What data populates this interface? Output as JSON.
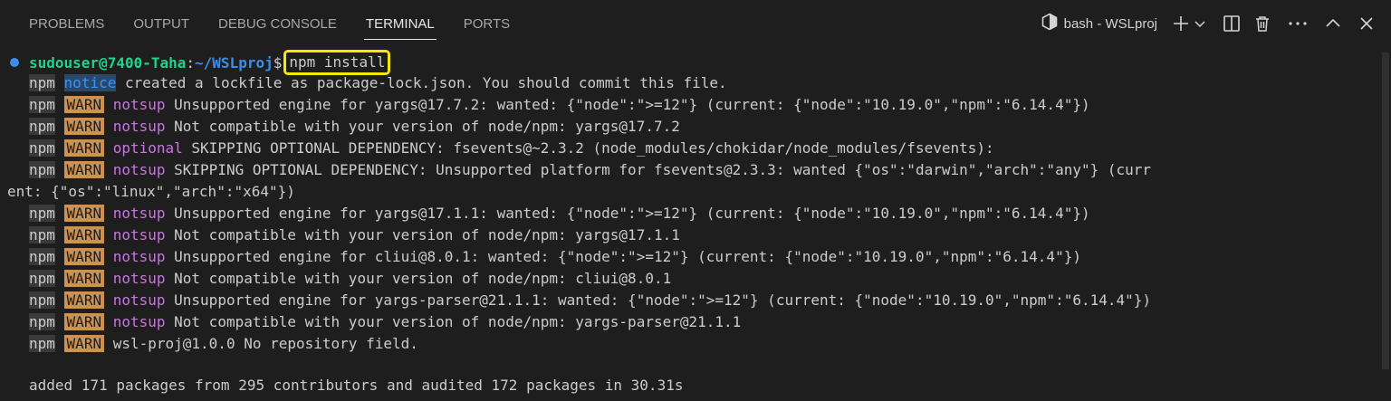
{
  "panel": {
    "tabs": [
      {
        "label": "PROBLEMS"
      },
      {
        "label": "OUTPUT"
      },
      {
        "label": "DEBUG CONSOLE"
      },
      {
        "label": "TERMINAL",
        "active": true
      },
      {
        "label": "PORTS"
      }
    ],
    "terminal_name": "bash - WSLproj",
    "icons": [
      "terminal-shell-icon",
      "plus-icon",
      "chevron-down-icon",
      "split-icon",
      "trash-icon",
      "more-icon",
      "chevron-up-icon",
      "close-icon"
    ]
  },
  "terminal": {
    "prompt": {
      "user": "sudouser@7400-Taha",
      "colon": ":",
      "path": "~/WSLproj",
      "dollar": "$",
      "command": "npm install"
    },
    "npm_label": "npm",
    "warn_label": "WARN",
    "notice_label": "notice",
    "lines": [
      {
        "badge": "notice",
        "tag": "",
        "text": " created a lockfile as package-lock.json. You should commit this file."
      },
      {
        "badge": "warn",
        "tag": "notsup",
        "text": " Unsupported engine for yargs@17.7.2: wanted: {\"node\":\">=12\"} (current: {\"node\":\"10.19.0\",\"npm\":\"6.14.4\"})"
      },
      {
        "badge": "warn",
        "tag": "notsup",
        "text": " Not compatible with your version of node/npm: yargs@17.7.2"
      },
      {
        "badge": "warn",
        "tag": "optional",
        "text": " SKIPPING OPTIONAL DEPENDENCY: fsevents@~2.3.2 (node_modules/chokidar/node_modules/fsevents):"
      },
      {
        "badge": "warn",
        "tag": "notsup",
        "text": " SKIPPING OPTIONAL DEPENDENCY: Unsupported platform for fsevents@2.3.3: wanted {\"os\":\"darwin\",\"arch\":\"any\"} (curr"
      },
      {
        "badge": "wrap",
        "tag": "",
        "text": "ent: {\"os\":\"linux\",\"arch\":\"x64\"})"
      },
      {
        "badge": "warn",
        "tag": "notsup",
        "text": " Unsupported engine for yargs@17.1.1: wanted: {\"node\":\">=12\"} (current: {\"node\":\"10.19.0\",\"npm\":\"6.14.4\"})"
      },
      {
        "badge": "warn",
        "tag": "notsup",
        "text": " Not compatible with your version of node/npm: yargs@17.1.1"
      },
      {
        "badge": "warn",
        "tag": "notsup",
        "text": " Unsupported engine for cliui@8.0.1: wanted: {\"node\":\">=12\"} (current: {\"node\":\"10.19.0\",\"npm\":\"6.14.4\"})"
      },
      {
        "badge": "warn",
        "tag": "notsup",
        "text": " Not compatible with your version of node/npm: cliui@8.0.1"
      },
      {
        "badge": "warn",
        "tag": "notsup",
        "text": " Unsupported engine for yargs-parser@21.1.1: wanted: {\"node\":\">=12\"} (current: {\"node\":\"10.19.0\",\"npm\":\"6.14.4\"})"
      },
      {
        "badge": "warn",
        "tag": "notsup",
        "text": " Not compatible with your version of node/npm: yargs-parser@21.1.1"
      },
      {
        "badge": "warn",
        "tag": "",
        "text": " wsl-proj@1.0.0 No repository field."
      }
    ],
    "summary": "added 171 packages from 295 contributors and audited 172 packages in 30.31s"
  },
  "colors": {
    "background": "#1e1e1e",
    "warn_badge": "#ce9150",
    "tag_purple": "#c678dd",
    "prompt_user": "#23d18b",
    "prompt_path": "#3b8eea",
    "command_highlight": "#f5e60c"
  }
}
